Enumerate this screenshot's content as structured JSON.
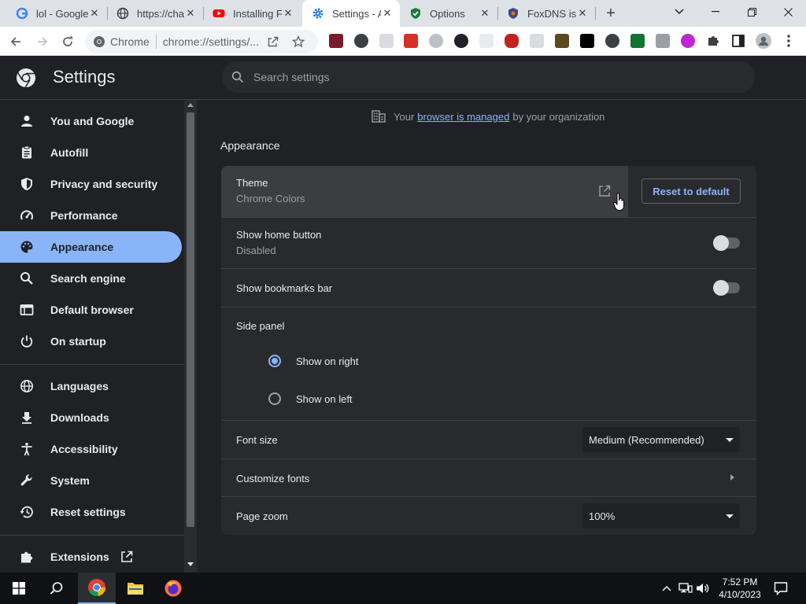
{
  "browser": {
    "tabs": [
      {
        "title": "lol - Google",
        "icon": "google-icon"
      },
      {
        "title": "https://chat",
        "icon": "globe-icon"
      },
      {
        "title": "Installing Fa",
        "icon": "youtube-icon"
      },
      {
        "title": "Settings - A",
        "icon": "settings-gear-icon",
        "active": true
      },
      {
        "title": "Options",
        "icon": "shield-check-icon"
      },
      {
        "title": "FoxDNS is",
        "icon": "foxdns-icon"
      }
    ],
    "omnibox": {
      "chrome_label": "Chrome",
      "url": "chrome://settings/..."
    }
  },
  "header": {
    "title": "Settings",
    "search_placeholder": "Search settings"
  },
  "sidebar": {
    "items": [
      {
        "label": "You and Google",
        "icon": "person-icon"
      },
      {
        "label": "Autofill",
        "icon": "clipboard-icon"
      },
      {
        "label": "Privacy and security",
        "icon": "shield-icon"
      },
      {
        "label": "Performance",
        "icon": "speedometer-icon"
      },
      {
        "label": "Appearance",
        "icon": "palette-icon",
        "active": true
      },
      {
        "label": "Search engine",
        "icon": "search-icon"
      },
      {
        "label": "Default browser",
        "icon": "browser-window-icon"
      },
      {
        "label": "On startup",
        "icon": "power-icon"
      },
      {
        "label": "Languages",
        "icon": "globe-icon"
      },
      {
        "label": "Downloads",
        "icon": "download-icon"
      },
      {
        "label": "Accessibility",
        "icon": "accessibility-icon"
      },
      {
        "label": "System",
        "icon": "wrench-icon"
      },
      {
        "label": "Reset settings",
        "icon": "history-icon"
      },
      {
        "label": "Extensions",
        "icon": "puzzle-icon"
      }
    ]
  },
  "main": {
    "managed": {
      "prefix": "Your",
      "link": "browser is managed",
      "suffix": "by your organization"
    },
    "section_title": "Appearance",
    "theme": {
      "label": "Theme",
      "value": "Chrome Colors",
      "reset_label": "Reset to default"
    },
    "home_button": {
      "label": "Show home button",
      "status": "Disabled",
      "enabled": false
    },
    "bookmarks_bar": {
      "label": "Show bookmarks bar",
      "enabled": false
    },
    "side_panel": {
      "label": "Side panel",
      "option_right": "Show on right",
      "option_left": "Show on left",
      "selected": "right"
    },
    "font_size": {
      "label": "Font size",
      "value": "Medium (Recommended)"
    },
    "customize_fonts": {
      "label": "Customize fonts"
    },
    "page_zoom": {
      "label": "Page zoom",
      "value": "100%"
    }
  },
  "taskbar": {
    "time": "7:52 PM",
    "date": "4/10/2023"
  },
  "colors": {
    "accent": "#8ab4f8",
    "background": "#202124",
    "card": "#292a2d"
  }
}
